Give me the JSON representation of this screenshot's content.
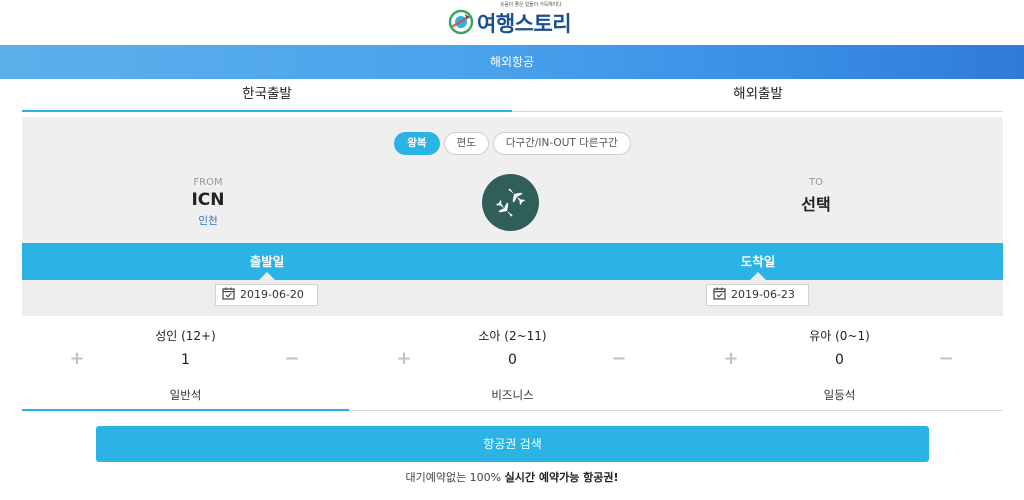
{
  "header": {
    "tagline": "웃음이 좋은 일들이 가득해지다.",
    "logo_text": "여행스토리",
    "section_title": "해외항공"
  },
  "direction_tabs": [
    {
      "label": "한국출발",
      "active": true
    },
    {
      "label": "해외출발",
      "active": false
    }
  ],
  "trip_types": [
    {
      "label": "왕복",
      "active": true
    },
    {
      "label": "편도",
      "active": false
    },
    {
      "label": "다구간/IN-OUT 다른구간",
      "active": false
    }
  ],
  "route": {
    "from_label": "FROM",
    "from_code": "ICN",
    "from_city": "인천",
    "to_label": "TO",
    "to_value": "선택",
    "swap_icon": "airplane-swap-icon"
  },
  "dates": {
    "departure_label": "출발일",
    "departure_value": "2019-06-20",
    "arrival_label": "도착일",
    "arrival_value": "2019-06-23"
  },
  "passengers": [
    {
      "label": "성인 (12+)",
      "count": "1"
    },
    {
      "label": "소아 (2~11)",
      "count": "0"
    },
    {
      "label": "유아 (0~1)",
      "count": "0"
    }
  ],
  "cabin_classes": [
    {
      "label": "일반석",
      "active": true
    },
    {
      "label": "비즈니스",
      "active": false
    },
    {
      "label": "일등석",
      "active": false
    }
  ],
  "search_button": "항공권 검색",
  "footer": {
    "prefix": "대기예약없는 100% ",
    "highlight": "실시간 예약가능 항공권!"
  },
  "colors": {
    "accent": "#2ab3e4",
    "swap_bg": "#2f5f58",
    "city_link": "#2a76c6",
    "logo": "#1d4f8f"
  }
}
